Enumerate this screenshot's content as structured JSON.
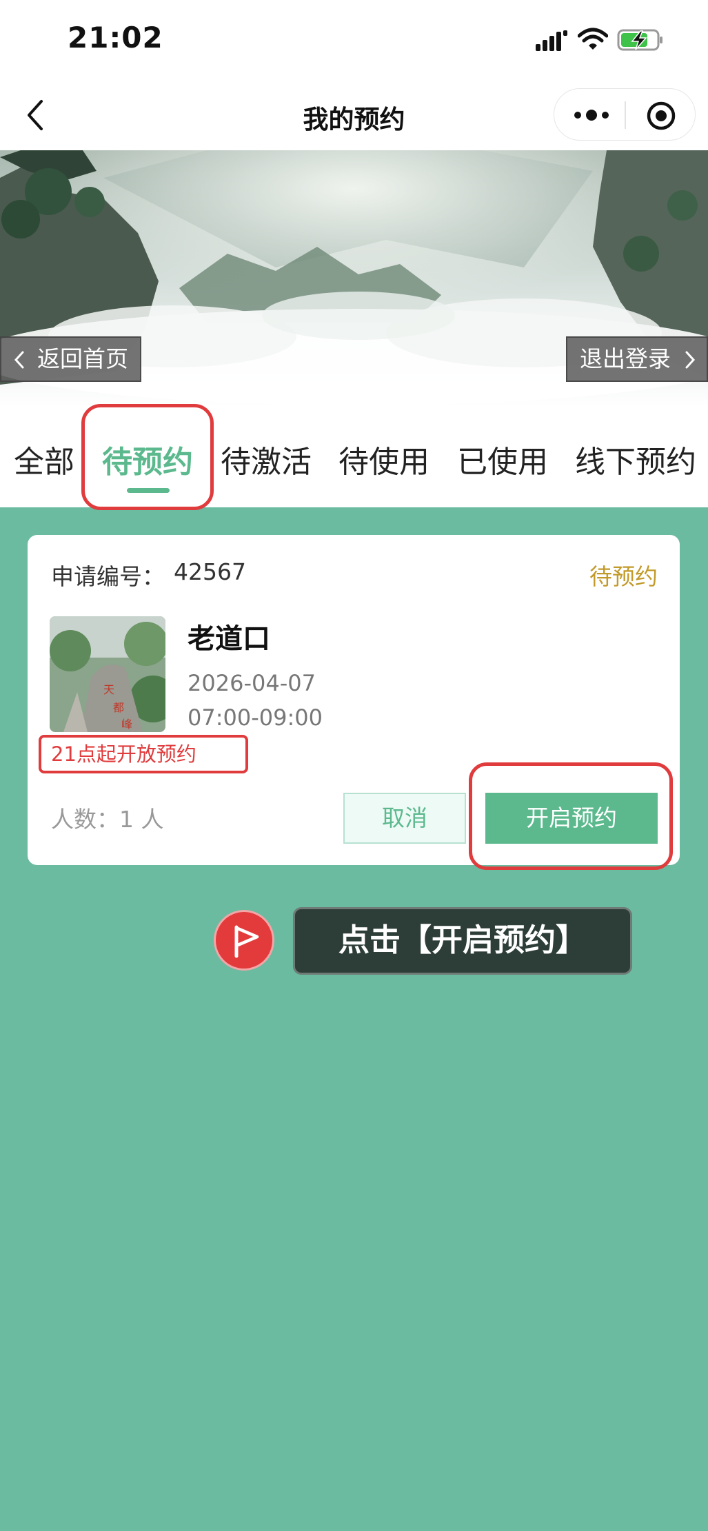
{
  "status_bar": {
    "time": "21:02",
    "icons": [
      "signal-icon",
      "wifi-icon",
      "battery-charging-icon"
    ]
  },
  "nav": {
    "title": "我的预约",
    "back_icon": "chevron-left-icon",
    "more_icon": "more-dots-icon",
    "close_icon": "target-circle-icon"
  },
  "banner": {
    "home_label": "返回首页",
    "logout_label": "退出登录"
  },
  "tabs": [
    {
      "label": "全部",
      "active": false
    },
    {
      "label": "待预约",
      "active": true
    },
    {
      "label": "待激活",
      "active": false
    },
    {
      "label": "待使用",
      "active": false
    },
    {
      "label": "已使用",
      "active": false
    },
    {
      "label": "线下预约",
      "active": false
    }
  ],
  "booking": {
    "app_no_label": "申请编号：",
    "app_no": "42567",
    "status": "待预约",
    "place_name": "老道口",
    "date": "2026-04-07",
    "time_range": "07:00-09:00",
    "open_notice": "21点起开放预约",
    "people": "人数：1 人",
    "cancel_label": "取消",
    "open_label": "开启预约"
  },
  "guide": {
    "tip": "点击【开启预约】",
    "icon": "flag-icon"
  },
  "colors": {
    "accent": "#5cb98e",
    "background": "#6bbba0",
    "status_pending": "#c29a2a",
    "highlight": "#e03b3d",
    "tip_bg": "#2d3d38"
  }
}
